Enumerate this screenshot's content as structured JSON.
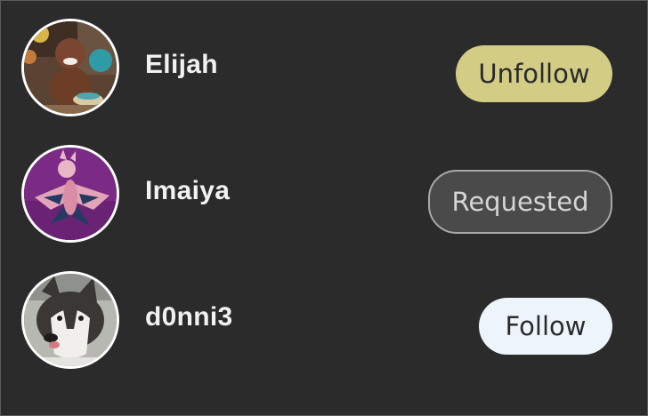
{
  "users": [
    {
      "name": "Elijah",
      "button_label": "Unfollow",
      "button_state": "following",
      "avatar_icon": "baby-photo-avatar"
    },
    {
      "name": "Imaiya",
      "button_label": "Requested",
      "button_state": "requested",
      "avatar_icon": "baby-costume-avatar"
    },
    {
      "name": "d0nni3",
      "button_label": "Follow",
      "button_state": "not-following",
      "avatar_icon": "husky-dog-avatar"
    }
  ],
  "colors": {
    "background": "#2b2b2b",
    "unfollow_button": "#d2cc85",
    "requested_button": "#4a4a4a",
    "follow_button": "#eef4fc",
    "avatar_border": "#ffffff"
  }
}
